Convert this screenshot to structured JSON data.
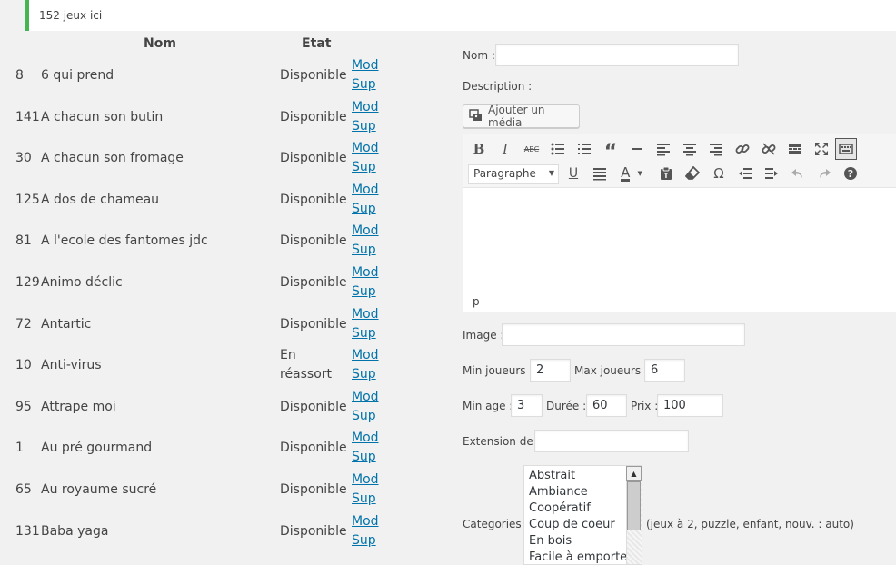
{
  "notice": {
    "text": "152 jeux ici"
  },
  "table": {
    "col_name": "Nom",
    "col_state": "Etat",
    "edit_label": "Mod",
    "delete_label": "Sup",
    "rows": [
      {
        "id": "8",
        "name": "6 qui prend",
        "state": "Disponible"
      },
      {
        "id": "141",
        "name": "A chacun son butin",
        "state": "Disponible"
      },
      {
        "id": "30",
        "name": "A chacun son fromage",
        "state": "Disponible"
      },
      {
        "id": "125",
        "name": "A dos de chameau",
        "state": "Disponible"
      },
      {
        "id": "81",
        "name": "A l'ecole des fantomes jdc",
        "state": "Disponible"
      },
      {
        "id": "129",
        "name": "Animo déclic",
        "state": "Disponible"
      },
      {
        "id": "72",
        "name": "Antartic",
        "state": "Disponible"
      },
      {
        "id": "10",
        "name": "Anti-virus",
        "state": "En réassort"
      },
      {
        "id": "95",
        "name": "Attrape moi",
        "state": "Disponible"
      },
      {
        "id": "1",
        "name": "Au pré gourmand",
        "state": "Disponible"
      },
      {
        "id": "65",
        "name": "Au royaume sucré",
        "state": "Disponible"
      },
      {
        "id": "131",
        "name": "Baba yaga",
        "state": "Disponible"
      }
    ]
  },
  "form": {
    "name_label": "Nom :",
    "name_value": "",
    "description_label": "Description :",
    "add_media_label": "Ajouter un média",
    "format_select": "Paragraphe",
    "status_path": "p",
    "image_label": "Image :",
    "image_value": "",
    "min_players_label": "Min joueurs :",
    "min_players_value": "2",
    "max_players_label": "Max joueurs :",
    "max_players_value": "6",
    "min_age_label": "Min age :",
    "min_age_value": "3",
    "duration_label": "Durée :",
    "duration_value": "60",
    "price_label": "Prix :",
    "price_value": "100",
    "extension_label": "Extension de :",
    "extension_value": "",
    "categories_label": "Categories :",
    "categories_hint": "(jeux à 2, puzzle, enfant, nouv. : auto)",
    "categories": [
      "Abstrait",
      "Ambiance",
      "Coopératif",
      "Coup de coeur",
      "En bois",
      "Facile à emporter"
    ]
  },
  "toolbar_icons": [
    "bold-icon",
    "italic-icon",
    "strikethrough-icon",
    "bullet-list-icon",
    "numbered-list-icon",
    "blockquote-icon",
    "horizontal-rule-icon",
    "align-left-icon",
    "align-center-icon",
    "align-right-icon",
    "link-icon",
    "unlink-icon",
    "read-more-icon",
    "fullscreen-icon",
    "toolbar-toggle-icon",
    "underline-icon",
    "justify-icon",
    "text-color-icon",
    "paste-text-icon",
    "clear-formatting-icon",
    "special-character-icon",
    "outdent-icon",
    "indent-icon",
    "undo-icon",
    "redo-icon",
    "help-icon"
  ],
  "colors": {
    "notice_border": "#46b450",
    "link": "#0073aa",
    "background": "#f1f1f1"
  }
}
